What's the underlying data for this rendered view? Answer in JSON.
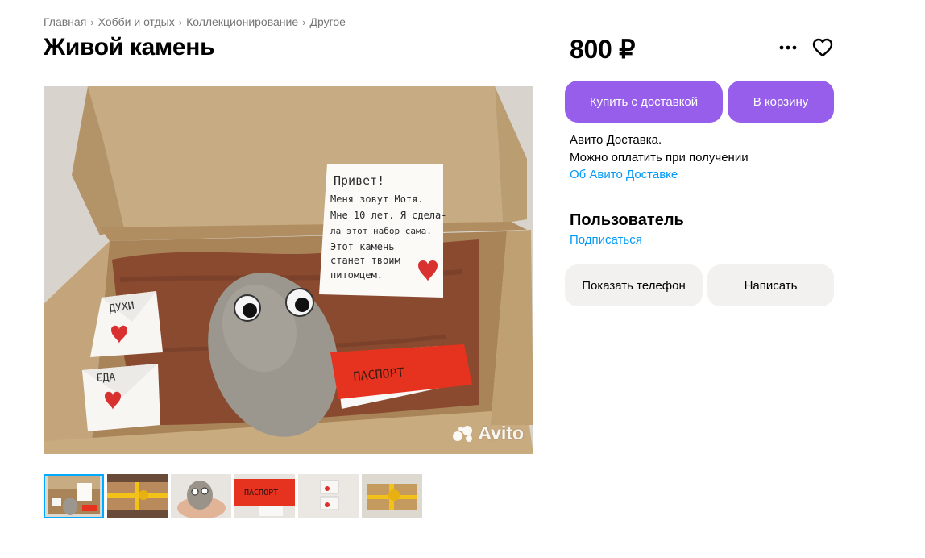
{
  "breadcrumb": {
    "items": [
      "Главная",
      "Хобби и отдых",
      "Коллекционирование",
      "Другое"
    ],
    "separator": "›"
  },
  "listing": {
    "title": "Живой камень",
    "price": "800 ₽"
  },
  "photo": {
    "watermark": "Avito",
    "note_lines": [
      "Привет!",
      "Меня зовут Мотя.",
      "Мне 10 лет. Я сдела-",
      "ла этот набор сама.",
      "Этот камень",
      "станет твоим",
      "питомцем."
    ],
    "tag_perfume": "ДУХИ",
    "tag_food": "ЕДА",
    "passport_label": "ПАСПОРТ",
    "thumbnail_count": 6,
    "active_thumbnail": 0
  },
  "actions": {
    "more_icon": "more-horizontal-icon",
    "favorite_icon": "heart-outline-icon",
    "buy_delivery": "Купить с доставкой",
    "add_to_cart": "В корзину"
  },
  "delivery": {
    "line1": "Авито Доставка.",
    "line2": "Можно оплатить при получении",
    "link": "Об Авито Доставке"
  },
  "seller": {
    "name": "Пользователь",
    "subscribe": "Подписаться"
  },
  "contact": {
    "show_phone": "Показать телефон",
    "write": "Написать"
  },
  "colors": {
    "accent_purple": "#965eeb",
    "link_blue": "#0099f7",
    "button_gray": "#f2f1f0",
    "active_thumb_border": "#00aaff"
  }
}
